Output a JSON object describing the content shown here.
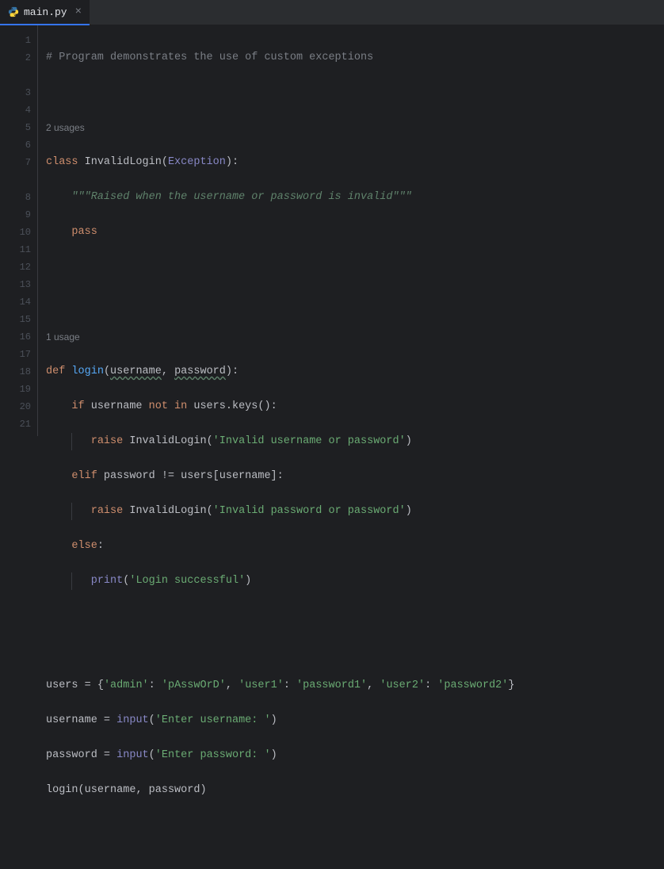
{
  "tab": {
    "label": "main.py",
    "icon": "python-file-icon"
  },
  "gutter": {
    "lines": [
      "1",
      "2",
      "",
      "3",
      "4",
      "5",
      "6",
      "7",
      "",
      "8",
      "9",
      "10",
      "11",
      "12",
      "13",
      "14",
      "15",
      "16",
      "17",
      "18",
      "19",
      "20",
      "21"
    ]
  },
  "inlay": {
    "class_usages": "2 usages",
    "func_usages": "1 usage"
  },
  "code": {
    "l1_comment": "# Program demonstrates the use of custom exceptions",
    "l3_kw_class": "class",
    "l3_name": "InvalidLogin",
    "l3_base": "Exception",
    "l4_docstr": "\"\"\"Raised when the username or password is invalid\"\"\"",
    "l5_kw_pass": "pass",
    "l8_kw_def": "def",
    "l8_name": "login",
    "l8_p1": "username",
    "l8_p2": "password",
    "l9_kw_if": "if",
    "l9_expr_a": "username",
    "l9_kw_notin": "not in",
    "l9_expr_b": "users.keys()",
    "l10_kw_raise": "raise",
    "l10_cls": "InvalidLogin",
    "l10_str": "'Invalid username or password'",
    "l11_kw_elif": "elif",
    "l11_expr": "password != users[username]",
    "l12_kw_raise": "raise",
    "l12_cls": "InvalidLogin",
    "l12_str": "'Invalid password or password'",
    "l13_kw_else": "else",
    "l14_fn": "print",
    "l14_str": "'Login successful'",
    "l17_ident": "users",
    "l17_dict": "{'admin': 'pAsswOrD', 'user1': 'password1', 'user2': 'password2'}",
    "l17_k1": "'admin'",
    "l17_v1": "'pAsswOrD'",
    "l17_k2": "'user1'",
    "l17_v2": "'password1'",
    "l17_k3": "'user2'",
    "l17_v3": "'password2'",
    "l18_ident": "username",
    "l18_fn": "input",
    "l18_str": "'Enter username: '",
    "l19_ident": "password",
    "l19_fn": "input",
    "l19_str": "'Enter password: '",
    "l20_call": "login",
    "l20_a1": "username",
    "l20_a2": "password"
  }
}
